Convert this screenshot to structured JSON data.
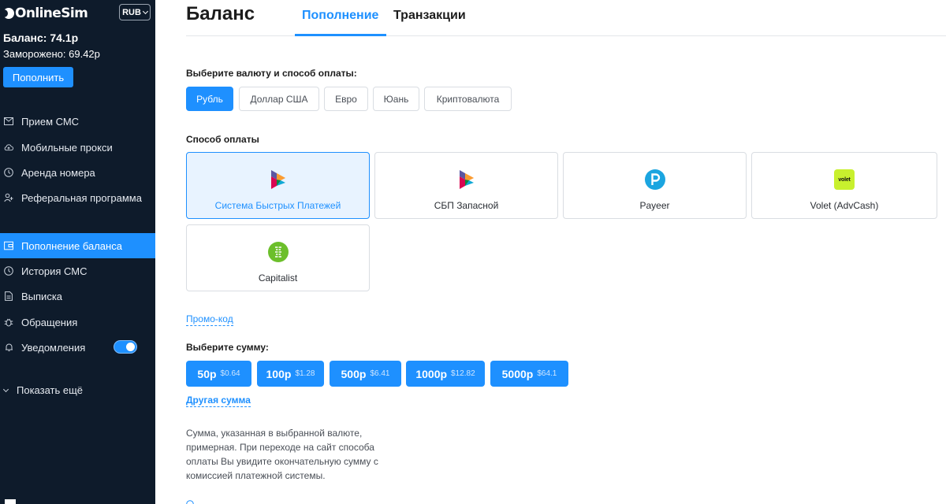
{
  "sidebar": {
    "logo": "OnlineSim",
    "currency": "RUB",
    "balance": "Баланс: 74.1р",
    "frozen": "Заморожено: 69.42р",
    "topup_button": "Пополнить",
    "nav_top": [
      {
        "label": "Прием СМС",
        "icon": "envelope-icon"
      },
      {
        "label": "Мобильные прокси",
        "icon": "cloud-upload-icon"
      },
      {
        "label": "Аренда номера",
        "icon": "clock-icon"
      },
      {
        "label": "Реферальная программа",
        "icon": "referral-icon"
      }
    ],
    "nav_bottom": [
      {
        "label": "Пополнение баланса",
        "icon": "wallet-icon",
        "active": true
      },
      {
        "label": "История СМС",
        "icon": "history-icon"
      },
      {
        "label": "Выписка",
        "icon": "document-icon"
      },
      {
        "label": "Обращения",
        "icon": "bug-icon"
      },
      {
        "label": "Уведомления",
        "icon": "bell-icon",
        "toggle": true
      }
    ],
    "show_more": "Показать ещё"
  },
  "header": {
    "title": "Баланс",
    "tabs": [
      {
        "label": "Пополнение",
        "active": true
      },
      {
        "label": "Транзакции",
        "active": false
      }
    ]
  },
  "currency_section": {
    "label": "Выберите валюту и способ оплаты:",
    "options": [
      {
        "label": "Рубль",
        "active": true
      },
      {
        "label": "Доллар США",
        "active": false
      },
      {
        "label": "Евро",
        "active": false
      },
      {
        "label": "Юань",
        "active": false
      },
      {
        "label": "Криптовалюта",
        "active": false
      }
    ]
  },
  "payment_section": {
    "label": "Способ оплаты",
    "methods": [
      {
        "label": "Система Быстрых Платежей",
        "icon": "sbp-icon",
        "active": true
      },
      {
        "label": "СБП Запасной",
        "icon": "sbp-icon",
        "active": false
      },
      {
        "label": "Payeer",
        "icon": "payeer-icon",
        "active": false
      },
      {
        "label": "Volet (AdvCash)",
        "icon": "volet-icon",
        "active": false,
        "icon_text": "volet"
      },
      {
        "label": "Capitalist",
        "icon": "capitalist-icon",
        "active": false
      }
    ]
  },
  "promo_link": "Промо-код",
  "amount_section": {
    "label": "Выберите сумму:",
    "amounts": [
      {
        "main": "50р",
        "sub": "$0.64"
      },
      {
        "main": "100р",
        "sub": "$1.28"
      },
      {
        "main": "500р",
        "sub": "$6.41"
      },
      {
        "main": "1000р",
        "sub": "$12.82"
      },
      {
        "main": "5000р",
        "sub": "$64.1"
      }
    ],
    "other_link": "Другая сумма"
  },
  "note": "Сумма, указанная в выбранной валюте, примерная. При переходе на сайт способа оплаты Вы увидите окончательную сумму с комиссией платежной системы.",
  "colors": {
    "accent": "#1e90ff",
    "sidebar_bg": "#0e1b2b",
    "volet_green": "#c8f02e",
    "capitalist_green": "#6cbf2b"
  }
}
